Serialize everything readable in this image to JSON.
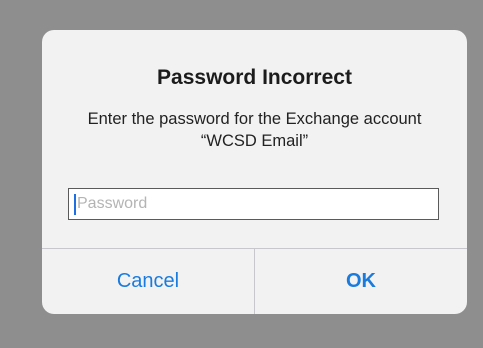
{
  "alert": {
    "title": "Password Incorrect",
    "message": "Enter the password for the Exchange account “WCSD Email”",
    "password_field": {
      "placeholder": "Password",
      "value": ""
    },
    "buttons": {
      "cancel_label": "Cancel",
      "ok_label": "OK"
    }
  },
  "colors": {
    "backdrop": "#8e8e8e",
    "alert_background": "#f2f2f2",
    "button_text": "#1a7bde",
    "caret": "#1f6fe0",
    "divider": "#c8c7cc"
  }
}
